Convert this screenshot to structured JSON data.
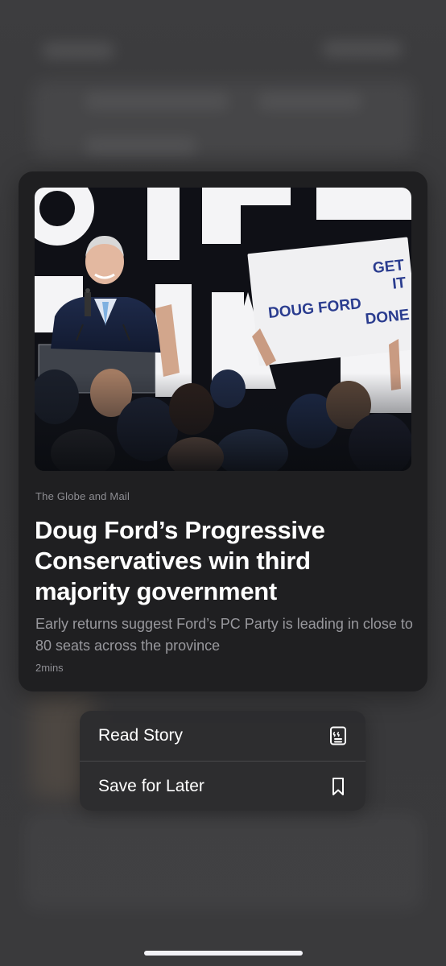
{
  "article": {
    "source": "The Globe and Mail",
    "headline": "Doug Ford’s Progressive Conservatives win third majority government",
    "summary": "Early returns suggest Ford’s PC Party is leading in close to 80 seats across the province",
    "read_time": "2mins",
    "image": {
      "sign_line1": "GET",
      "sign_name": "DOUG FORD",
      "sign_line2": "IT",
      "sign_line3": "DONE"
    }
  },
  "context_menu": {
    "items": [
      {
        "label": "Read Story",
        "icon": "news-quote-icon"
      },
      {
        "label": "Save for Later",
        "icon": "bookmark-icon"
      }
    ]
  },
  "colors": {
    "card_background": "#1f1f21",
    "menu_background": "#2c2c2e",
    "sign_text_blue": "#2a3c8f"
  }
}
